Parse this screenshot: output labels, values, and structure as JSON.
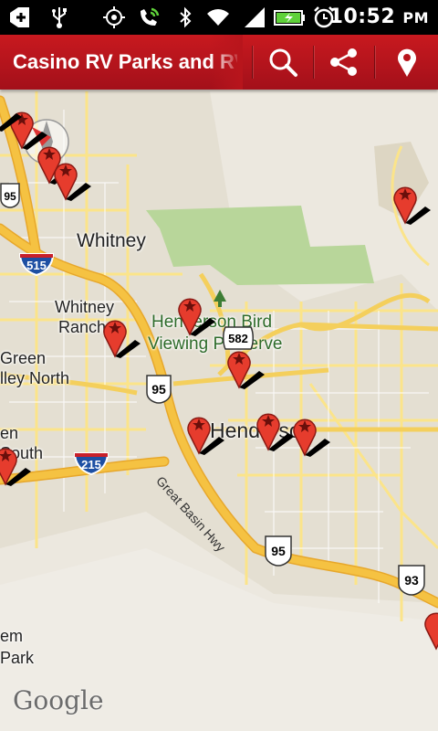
{
  "status_bar": {
    "time": "10:52",
    "ampm": "PM",
    "icons": [
      "add-icon",
      "usb-icon",
      "gps-icon",
      "phone-signal-icon",
      "bluetooth-icon",
      "wifi-icon",
      "cell-signal-icon",
      "battery-icon",
      "alarm-icon"
    ]
  },
  "action_bar": {
    "title": "Casino RV Parks and RV",
    "buttons": [
      "search-icon",
      "share-icon",
      "location-pin-icon"
    ]
  },
  "map": {
    "labels": {
      "whitney": "Whitney",
      "whitney_ranch_1": "Whitney",
      "whitney_ranch_2": "Ranch",
      "henderson_bird_1": "Henderson Bird",
      "henderson_bird_2": "Viewing Preserve",
      "green_valley_north_1": "Green",
      "green_valley_north_2": "lley North",
      "green_valley_south_1": "en",
      "green_valley_south_2": "South",
      "henderson": "Henderson",
      "great_basin": "Great Basin Hwy",
      "park_1": "em",
      "park_2": "Park"
    },
    "shields": {
      "i515": "515",
      "i215": "215",
      "us95_a": "95",
      "us95_b": "95",
      "us95_c": "95",
      "us95_d": "95",
      "sr582": "582",
      "us93": "93"
    },
    "attribution": "Google"
  },
  "colors": {
    "action_bar": "#b8151c",
    "map_bg": "#ece8df",
    "major_road": "#f5c242",
    "minor_road": "#fbe48a",
    "park": "#b8d69a",
    "pin": "#e63c2d"
  }
}
